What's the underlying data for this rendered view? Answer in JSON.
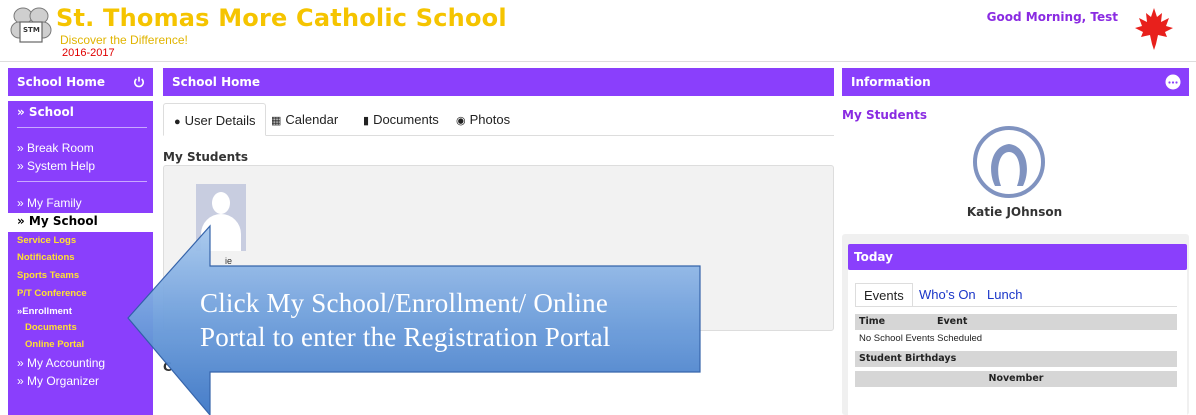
{
  "header": {
    "school_name": "St. Thomas More Catholic School",
    "tagline": "Discover the Difference!",
    "year": "2016-2017",
    "greeting": "Good Morning, Test",
    "logo_text": "STM"
  },
  "colors": {
    "accent": "#8a3ffc",
    "school_name": "#f5c400",
    "year": "#e00000",
    "greeting": "#8a2be2",
    "submenu": "#ffe033",
    "link": "#1a36c8"
  },
  "sidebar": {
    "title": "School Home",
    "power_icon": "power-icon",
    "items": [
      {
        "label": "» School"
      },
      {
        "label": "» Break Room"
      },
      {
        "label": "» System Help"
      },
      {
        "label": "» My Family"
      },
      {
        "label": "» My School"
      },
      {
        "label": "Service Logs"
      },
      {
        "label": "Notifications"
      },
      {
        "label": "Sports Teams"
      },
      {
        "label": "P/T Conference"
      },
      {
        "label": "»Enrollment"
      },
      {
        "label": "Documents"
      },
      {
        "label": "Online Portal"
      },
      {
        "label": "» My Accounting"
      },
      {
        "label": "» My Organizer"
      }
    ]
  },
  "main": {
    "title": "School Home",
    "tabs": [
      {
        "label": "User Details",
        "icon": "user-icon"
      },
      {
        "label": "Calendar",
        "icon": "calendar-icon"
      },
      {
        "label": "Documents",
        "icon": "document-icon"
      },
      {
        "label": "Photos",
        "icon": "camera-icon"
      }
    ],
    "section_title": "My Students",
    "student_card_name": "ie",
    "second_section_initial": "C"
  },
  "info": {
    "title": "Information",
    "sub_title": "My Students",
    "student_name": "Katie JOhnson",
    "today": {
      "title": "Today",
      "tabs": [
        "Events",
        "Who's On",
        "Lunch"
      ],
      "col_time": "Time",
      "col_event": "Event",
      "no_events": "No School Events Scheduled",
      "birthdays_title": "Student Birthdays",
      "month": "November"
    }
  },
  "callout": {
    "line1": "Click My School/Enrollment/ Online",
    "line2": "Portal to enter the Registration Portal"
  }
}
